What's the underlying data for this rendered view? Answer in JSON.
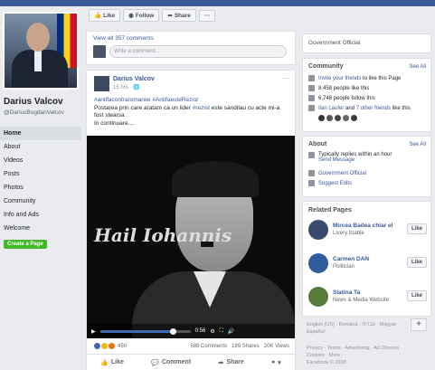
{
  "page": {
    "name": "Darius Valcov",
    "handle": "@DariusBogdanValcov"
  },
  "nav": [
    "Home",
    "About",
    "Videos",
    "Posts",
    "Photos",
    "Community",
    "Info and Ads",
    "Welcome"
  ],
  "create_page_label": "Create a Page",
  "actions": {
    "like": "Like",
    "follow": "Follow",
    "share": "Share",
    "more": "···"
  },
  "comments_bar": {
    "view_comments": "View all 357 comments",
    "placeholder": "Write a comment..."
  },
  "post": {
    "author": "Darius Valcov",
    "time": "15 hrs · ",
    "hashtags": [
      "#antifacontraromaniei",
      "#AntifaesteRezist"
    ],
    "text_1": "Postarea prin care aratam ca un lider ",
    "hashtag_inline": "#rezist",
    "text_2": " este sandilau cu acte mi-a fost stearsa",
    "text_3": "In continuare....",
    "video_text": "Hail Iohannis",
    "video_time": "0:56",
    "video_progress_pct": 80,
    "reactions_count": "450",
    "comments_count": "588 Comments",
    "shares_count": "189 Shares",
    "views_count": "20K Views",
    "like_label": "Like",
    "comment_label": "Comment",
    "share_label": "Share"
  },
  "right": {
    "category": "Government Official",
    "community_title": "Community",
    "see_all": "See All",
    "invite": "Invite your friends",
    "invite_suffix": " to like this Page",
    "likes": "8,458 people like this",
    "follows": "6,748 people follow this",
    "friends_prefix": "Ilan Laufer",
    "friends_mid": " and ",
    "friends_link": "7 other friends",
    "friends_suffix": " like this",
    "about_title": "About",
    "reply_time": "Typically replies within an hour",
    "send_message": "Send Message",
    "gov": "Government Official",
    "suggest": "Suggest Edits",
    "related_title": "Related Pages",
    "related": [
      {
        "name": "Mircea Badea chiar el",
        "sub": "Livery Stable",
        "like": "Like"
      },
      {
        "name": "Carmen DAN",
        "sub": "Politician",
        "like": "Like"
      },
      {
        "name": "Slatina Ta",
        "sub": "News & Media Website",
        "like": "Like"
      }
    ],
    "languages": "English (US) · Română · עברית · Magyar · Español",
    "footer_1": "Privacy · Terms · Advertising · Ad Choices ·",
    "footer_2": "Cookies · More ·",
    "footer_3": "Facebook © 2018"
  },
  "colors": {
    "fb_blue": "#3b5998",
    "link": "#385898",
    "green": "#42b72a"
  }
}
